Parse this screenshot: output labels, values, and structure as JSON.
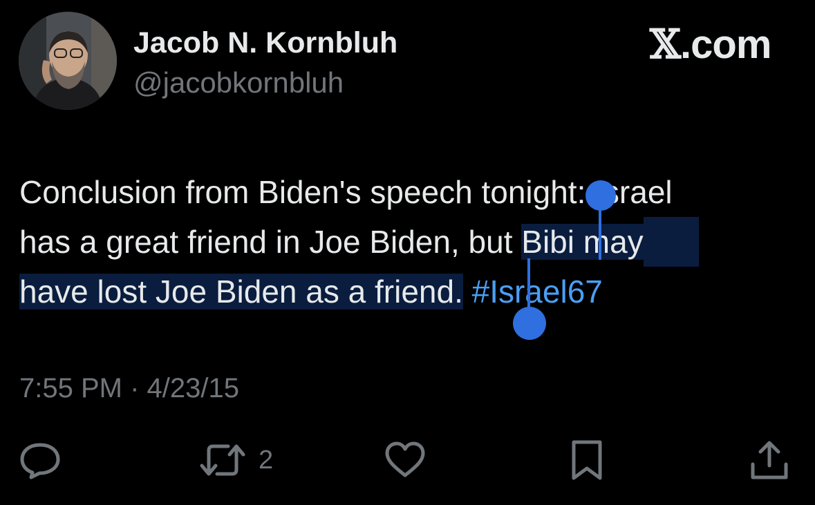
{
  "author": {
    "display_name": "Jacob N. Kornbluh",
    "handle": "@jacobkornbluh"
  },
  "brand": {
    "x_glyph": "𝕏",
    "suffix": ".com"
  },
  "tweet": {
    "line1": "Conclusion from Biden's speech tonight: Israel",
    "line2_unselected": "has a great friend in Joe Biden, but ",
    "line2_selected": "Bibi may",
    "line3_selected": "have lost Joe Biden as a friend.",
    "line3_space": " ",
    "hashtag": "#Israel67"
  },
  "timestamp": "7:55 PM · 4/23/15",
  "actions": {
    "reply_icon": "reply-icon",
    "retweet_icon": "retweet-icon",
    "retweet_count": "2",
    "like_icon": "heart-icon",
    "bookmark_icon": "bookmark-icon",
    "share_icon": "share-icon"
  },
  "colors": {
    "background": "#000000",
    "text": "#e7e9ea",
    "secondary": "#71767b",
    "link": "#4a9ff5",
    "selection": "#0a1d3f",
    "selection_handle": "#2f6fe0"
  }
}
